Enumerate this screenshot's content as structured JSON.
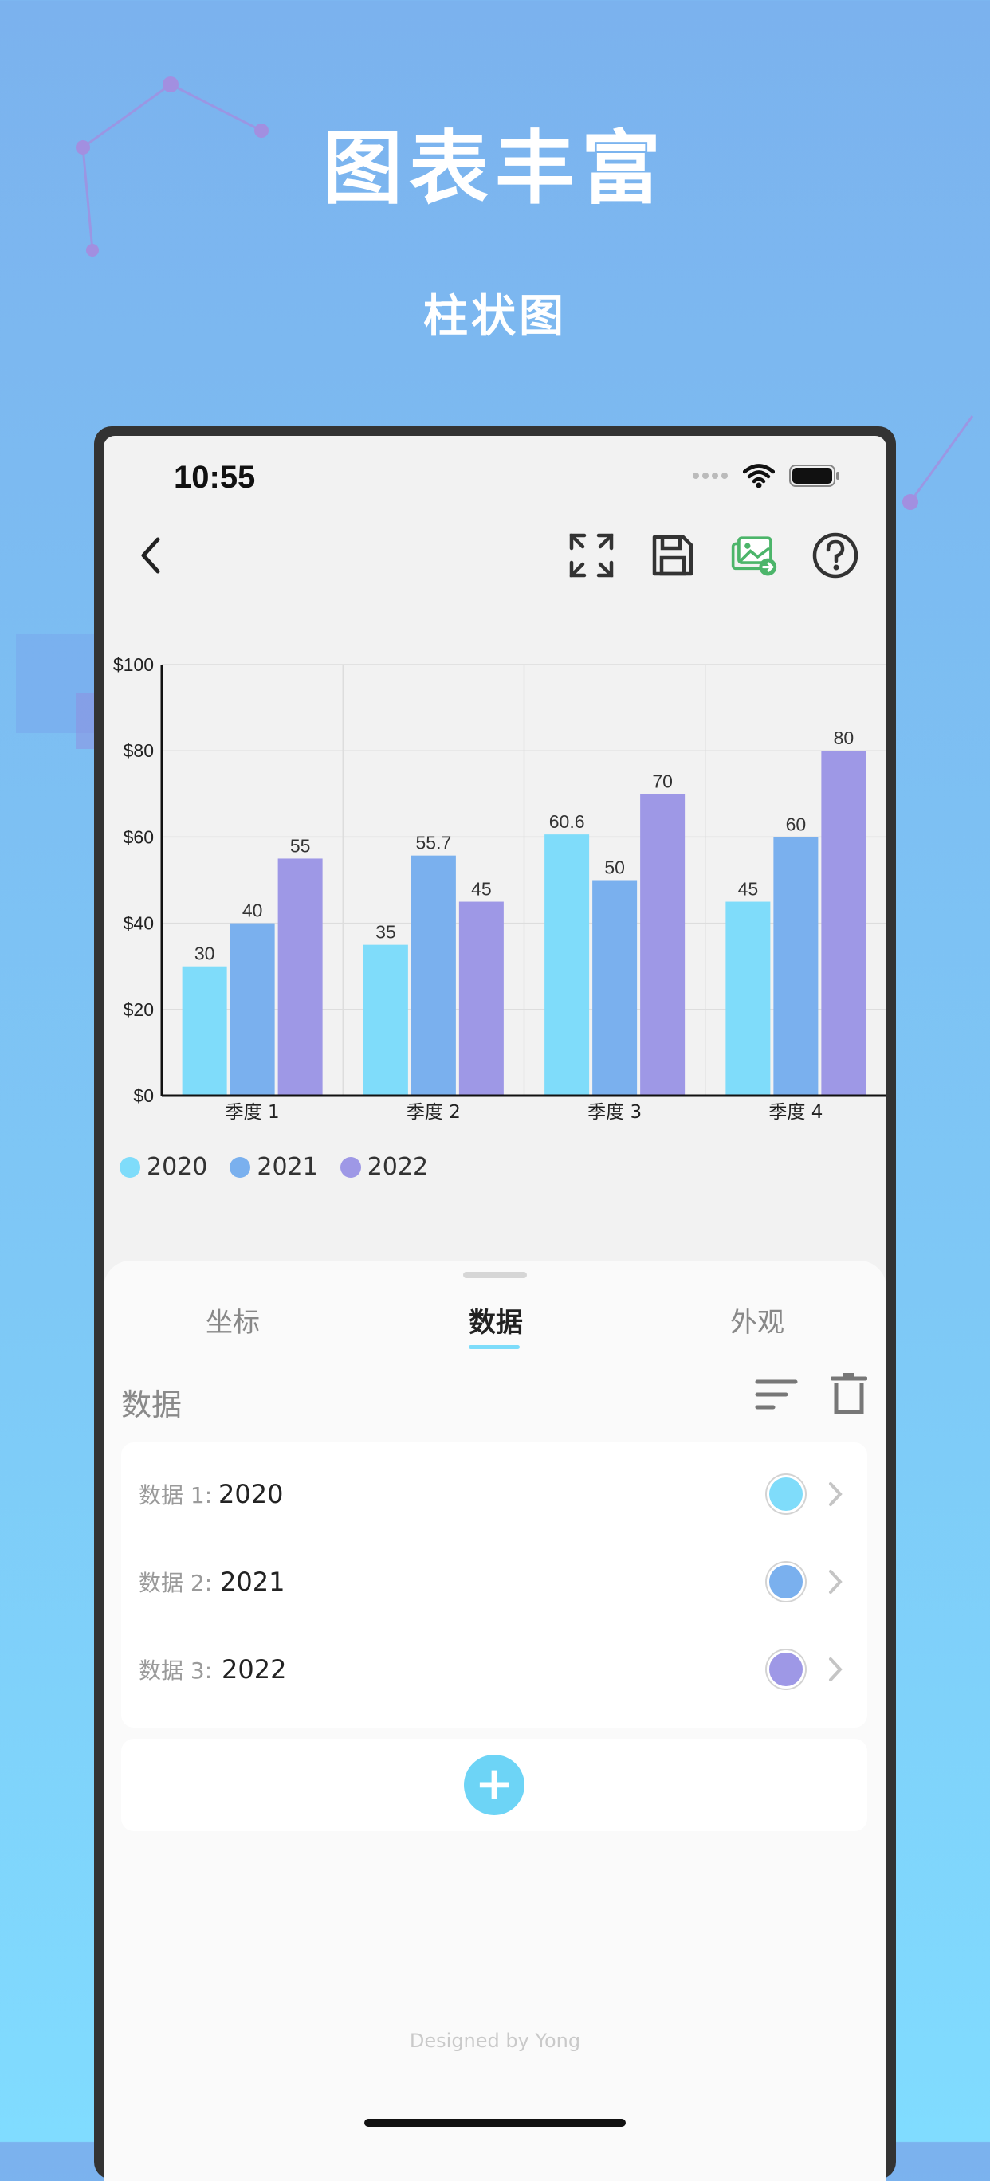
{
  "hero": {
    "title": "图表丰富",
    "subtitle": "柱状图"
  },
  "status_bar": {
    "time": "10:55"
  },
  "nav": {
    "back_icon": "chevron-left-icon",
    "actions": [
      "fullscreen-icon",
      "save-icon",
      "export-image-icon",
      "help-icon"
    ]
  },
  "chart_data": {
    "type": "bar",
    "categories": [
      "季度 1",
      "季度 2",
      "季度 3",
      "季度 4"
    ],
    "series": [
      {
        "name": "2020",
        "values": [
          30,
          35,
          60.6,
          45
        ],
        "color": "#7fdcfa"
      },
      {
        "name": "2021",
        "values": [
          40,
          55.7,
          50,
          60
        ],
        "color": "#7ab0ee"
      },
      {
        "name": "2022",
        "values": [
          55,
          45,
          70,
          80
        ],
        "color": "#9e98e6"
      }
    ],
    "ylim": [
      0,
      100
    ],
    "y_ticks": [
      "$0",
      "$20",
      "$40",
      "$60",
      "$80",
      "$100"
    ],
    "grid": true,
    "legend_position": "bottom-left"
  },
  "sheet": {
    "tabs": [
      {
        "label": "坐标"
      },
      {
        "label": "数据",
        "active": true
      },
      {
        "label": "外观"
      }
    ],
    "section_title": "数据",
    "rows": [
      {
        "label": "数据 1:",
        "value": "2020",
        "color": "#7fdcfa"
      },
      {
        "label": "数据 2:",
        "value": "2021",
        "color": "#7ab0ee"
      },
      {
        "label": "数据 3:",
        "value": "2022",
        "color": "#9e98e6"
      }
    ],
    "add_label": "+",
    "footer": "Designed by Yong"
  }
}
